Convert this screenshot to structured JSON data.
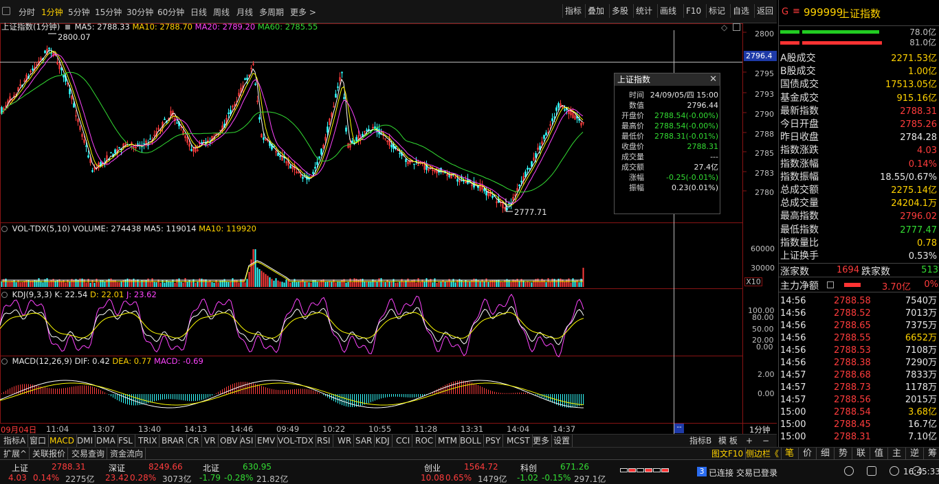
{
  "toolbar": {
    "periods": [
      "分时",
      "1分钟",
      "5分钟",
      "15分钟",
      "30分钟",
      "60分钟",
      "日线",
      "周线",
      "月线",
      "多周期",
      "更多 >"
    ],
    "active_period": "1分钟",
    "right_buttons": [
      "指标",
      "叠加",
      "多股",
      "统计",
      "画线",
      "F10",
      "标记",
      "自选",
      "返回"
    ]
  },
  "main_panel": {
    "title": "上证指数(1分钟)",
    "ma5": "MA5: 2788.33",
    "ma10": "MA10: 2788.70",
    "ma20": "MA20: 2789.20",
    "ma60": "MA60: 2785.55",
    "high_label": "2800.07",
    "low_label": "2777.71",
    "crosshair_price": "2796.4",
    "y_ticks": [
      "2800",
      "2795",
      "2793",
      "2790",
      "2788",
      "2785",
      "2783",
      "2780"
    ]
  },
  "volume_panel": {
    "title": "VOL-TDX(5,10)",
    "volume": "VOLUME: 274438",
    "ma5": "MA5: 119014",
    "ma10": "MA10: 119920",
    "y_ticks": [
      "60000",
      "30000"
    ],
    "unit": "X10"
  },
  "kdj_panel": {
    "title": "KDJ(9,3,3)",
    "k": "K: 22.54",
    "d": "D: 22.01",
    "j": "J: 23.62",
    "y_ticks": [
      "100.00",
      "80.00",
      "50.00",
      "20.00",
      "0.00"
    ]
  },
  "macd_panel": {
    "title": "MACD(12,26,9)",
    "dif": "DIF: 0.42",
    "dea": "DEA: 0.77",
    "macd": "MACD: -0.69",
    "y_ticks": [
      "2.00",
      "0.00"
    ]
  },
  "x_axis": {
    "labels": [
      "09月04日",
      "11:04",
      "13:07",
      "13:40",
      "14:13",
      "14:46",
      "09:49",
      "10:22",
      "10:55",
      "11:28",
      "13:31",
      "14:04",
      "14:37"
    ],
    "period_label": "1分钟",
    "cursor_label": "--"
  },
  "tooltip": {
    "title": "上证指数",
    "rows": [
      {
        "k": "时间",
        "v": "24/09/05/四 15:00",
        "c": "white"
      },
      {
        "k": "数值",
        "v": "2796.44",
        "c": "white"
      },
      {
        "k": "开盘价",
        "v": "2788.54(-0.00%)",
        "c": "green"
      },
      {
        "k": "最高价",
        "v": "2788.54(-0.00%)",
        "c": "green"
      },
      {
        "k": "最低价",
        "v": "2788.31(-0.01%)",
        "c": "green"
      },
      {
        "k": "收盘价",
        "v": "2788.31",
        "c": "green"
      },
      {
        "k": "成交量",
        "v": "---",
        "c": "white"
      },
      {
        "k": "成交额",
        "v": "27.4亿",
        "c": "white"
      },
      {
        "k": "涨幅",
        "v": "-0.25(-0.01%)",
        "c": "green"
      },
      {
        "k": "振幅",
        "v": "0.23(0.01%)",
        "c": "white"
      }
    ]
  },
  "indicator_tabs": [
    "指标A",
    "窗口",
    "MACD",
    "DMI",
    "DMA",
    "FSL",
    "TRIX",
    "BRAR",
    "CR",
    "VR",
    "OBV",
    "ASI",
    "EMV",
    "VOL-TDX",
    "RSI",
    "WR",
    "SAR",
    "KDJ",
    "CCI",
    "ROC",
    "MTM",
    "BOLL",
    "PSY",
    "MCST",
    "更多",
    "设置"
  ],
  "active_indicator": "MACD",
  "tabs_right": [
    "指标B",
    "模 板",
    "+",
    "−"
  ],
  "sub_tabs": [
    "扩展^",
    "关联报价",
    "交易查询",
    "资金流向"
  ],
  "sub_tabs_right": [
    "图文F10",
    "侧边栏《"
  ],
  "quote_tabs": [
    "笔",
    "价",
    "细",
    "势",
    "联",
    "值",
    "主",
    "逆",
    "筹"
  ],
  "right_panel": {
    "code": "999999",
    "name": "上证指数",
    "g_label": "G",
    "bar_top_value": "78.0亿",
    "bar_bottom_value": "81.0亿",
    "stats": [
      {
        "k": "A股成交",
        "v": "2271.53亿",
        "c": "yellow"
      },
      {
        "k": "B股成交",
        "v": "1.00亿",
        "c": "yellow"
      },
      {
        "k": "国债成交",
        "v": "17513.05亿",
        "c": "yellow"
      },
      {
        "k": "基金成交",
        "v": "915.16亿",
        "c": "yellow"
      },
      {
        "k": "最新指数",
        "v": "2788.31",
        "c": "red"
      },
      {
        "k": "今日开盘",
        "v": "2785.26",
        "c": "red"
      },
      {
        "k": "昨日收盘",
        "v": "2784.28",
        "c": "white"
      },
      {
        "k": "指数涨跌",
        "v": "4.03",
        "c": "red"
      },
      {
        "k": "指数涨幅",
        "v": "0.14%",
        "c": "red"
      },
      {
        "k": "指数振幅",
        "v": "18.55/0.67%",
        "c": "white"
      },
      {
        "k": "总成交额",
        "v": "2275.14亿",
        "c": "yellow"
      },
      {
        "k": "总成交量",
        "v": "24204.1万",
        "c": "yellow"
      },
      {
        "k": "最高指数",
        "v": "2796.02",
        "c": "red"
      },
      {
        "k": "最低指数",
        "v": "2777.47",
        "c": "green"
      },
      {
        "k": "指数量比",
        "v": "0.78",
        "c": "yellow"
      },
      {
        "k": "上证换手",
        "v": "0.53%",
        "c": "white"
      }
    ],
    "up_label": "涨家数",
    "up_count": "1694",
    "down_label": "跌家数",
    "down_count": "513",
    "net_label": "主力净额",
    "net_value": "3.70亿",
    "net_pct": "0%",
    "ticks": [
      {
        "t": "14:56",
        "p": "2788.58",
        "a": "7540万",
        "ac": "white"
      },
      {
        "t": "14:56",
        "p": "2788.52",
        "a": "7013万",
        "ac": "white"
      },
      {
        "t": "14:56",
        "p": "2788.65",
        "a": "7375万",
        "ac": "white"
      },
      {
        "t": "14:56",
        "p": "2788.55",
        "a": "6652万",
        "ac": "yellow"
      },
      {
        "t": "14:56",
        "p": "2788.53",
        "a": "7108万",
        "ac": "white"
      },
      {
        "t": "14:56",
        "p": "2788.38",
        "a": "7290万",
        "ac": "white"
      },
      {
        "t": "14:57",
        "p": "2788.68",
        "a": "7833万",
        "ac": "white"
      },
      {
        "t": "14:57",
        "p": "2788.73",
        "a": "1178万",
        "ac": "white"
      },
      {
        "t": "14:57",
        "p": "2788.56",
        "a": "2015万",
        "ac": "white"
      },
      {
        "t": "15:00",
        "p": "2788.54",
        "a": "3.68亿",
        "ac": "yellow"
      },
      {
        "t": "15:00",
        "p": "2788.45",
        "a": "16.7亿",
        "ac": "white"
      },
      {
        "t": "15:00",
        "p": "2788.31",
        "a": "7.10亿",
        "ac": "white"
      }
    ]
  },
  "status_bar": {
    "indices": [
      {
        "name": "上证",
        "price": "2788.31",
        "chg": "4.03",
        "pct": "0.14%",
        "amt": "2275亿",
        "pc": "red"
      },
      {
        "name": "深证",
        "price": "8249.66",
        "chg": "23.42",
        "pct": "0.28%",
        "amt": "3073亿",
        "pc": "red"
      },
      {
        "name": "北证",
        "price": "630.95",
        "chg": "-1.79",
        "pct": "-0.28%",
        "amt": "21.82亿",
        "pc": "green"
      },
      {
        "name": "创业",
        "price": "1564.72",
        "chg": "10.08",
        "pct": "0.65%",
        "amt": "1479亿",
        "pc": "red"
      },
      {
        "name": "科创",
        "price": "671.26",
        "chg": "-1.02",
        "pct": "-0.15%",
        "amt": "297.1亿",
        "pc": "green"
      }
    ],
    "connection": "已连接",
    "trade": "交易已登录",
    "badge": "3",
    "time": "16:45:33"
  },
  "colors": {
    "up": "#ff3c3c",
    "down": "#33dd33",
    "accent": "#ffd200",
    "ma5": "#ffffff",
    "ma10": "#ffff00",
    "ma20": "#ff44ff",
    "ma60": "#33dd33"
  }
}
